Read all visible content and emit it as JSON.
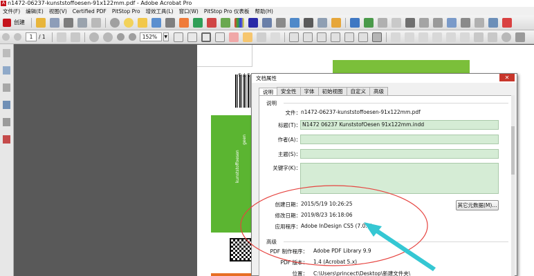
{
  "window": {
    "title": "n1472-06237-kunststoffoesen-91x122mm.pdf - Adobe Acrobat Pro"
  },
  "menu": [
    "文件(F)",
    "编辑(E)",
    "视图(V)",
    "Certified PDF",
    "PitStop Pro",
    "增效工具(L)",
    "窗口(W)",
    "PitStop Pro 仪表板",
    "帮助(H)"
  ],
  "toolbar": {
    "create_label": "创建",
    "page_current": "1",
    "page_total": "/ 1",
    "zoom": "152%",
    "zoom_arrow": "▼"
  },
  "document": {
    "barcode_digits": "375",
    "side_text": "geen",
    "side_text2": "kunststoffoesen"
  },
  "dialog": {
    "title": "文档属性",
    "close": "✕",
    "tabs": [
      "说明",
      "安全性",
      "字体",
      "初始视图",
      "自定义",
      "高级"
    ],
    "description": {
      "section": "说明",
      "file_label": "文件：",
      "file_value": "n1472-06237-kunststoffoesen-91x122mm.pdf",
      "title_label": "标题(T)：",
      "title_value": "N1472 06237 KunststofOesen 91x122mm.indd",
      "author_label": "作者(A)：",
      "author_value": "",
      "subject_label": "主题(S)：",
      "subject_value": "",
      "keywords_label": "关键字(K)：",
      "keywords_value": "",
      "created_label": "创建日期：",
      "created_value": "2015/5/19 10:26:25",
      "modified_label": "修改日期：",
      "modified_value": "2019/8/23 16:18:06",
      "app_label": "应用程序：",
      "app_value": "Adobe InDesign CS5 (7.0.4)",
      "more_metadata_button": "其它元数据(M)..."
    },
    "advanced": {
      "section": "高级",
      "producer_label": "PDF 制作程序：",
      "producer_value": "Adobe PDF Library 9.9",
      "version_label": "PDF 版本：",
      "version_value": "1.4 (Acrobat 5.x)",
      "location_label": "位置：",
      "location_value": "C:\\Users\\princect\\Desktop\\新建文件夹\\"
    }
  },
  "colors": {
    "accent_green": "#5bb531",
    "annotation_red": "#e6433f",
    "annotation_arrow": "#35c7d3"
  }
}
